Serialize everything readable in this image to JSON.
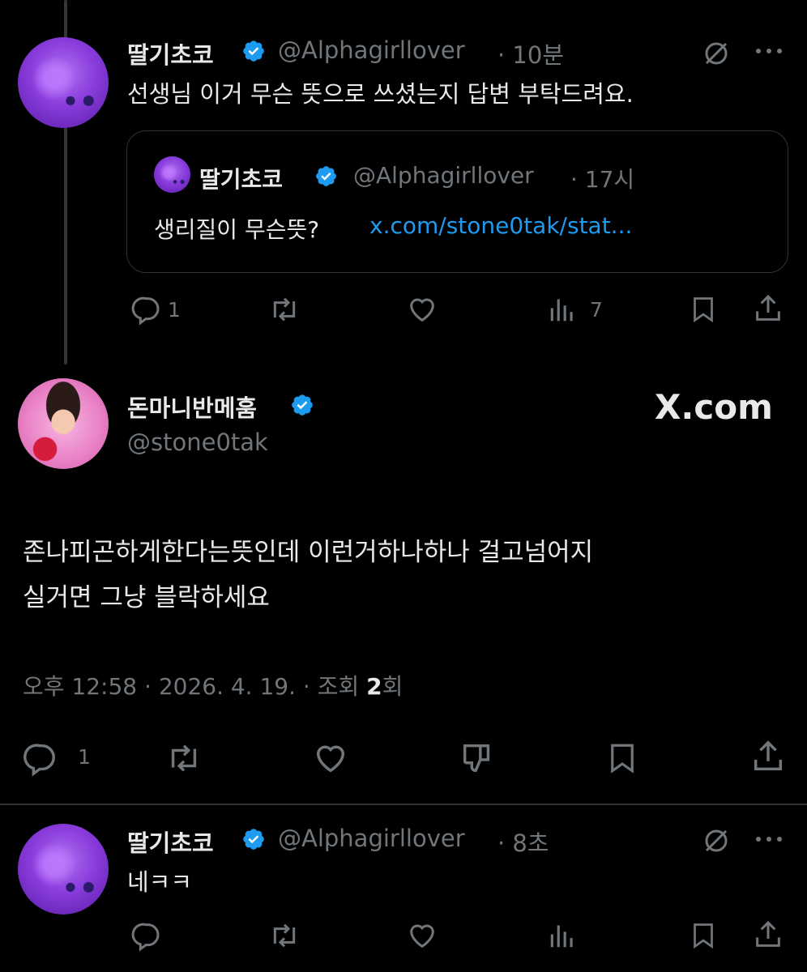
{
  "reply1": {
    "name": "딸기초코",
    "handle": "@Alphagirllover",
    "time": "· 10분",
    "text": "선생님 이거 무슨 뜻으로 쓰셨는지 답변 부탁드려요.",
    "quote": {
      "name": "딸기초코",
      "handle": "@Alphagirllover",
      "time": "· 17시",
      "text": "생리질이 무슨뜻?",
      "link": "x.com/stone0tak/stat..."
    },
    "actions": {
      "reply_count": "1",
      "views_count": "7"
    }
  },
  "main": {
    "name": "돈마니반메훔",
    "handle": "@stone0tak",
    "brand": "X.com",
    "text_line1": "존나피곤하게한다는뜻인데 이런거하나하나 걸고넘어지",
    "text_line2": "실거면 그냥 블락하세요",
    "meta_prefix": "오후 12:58 · 2026. 4. 19. · 조회 ",
    "views": "2",
    "meta_suffix": "회",
    "actions": {
      "reply_count": "1"
    }
  },
  "reply2": {
    "name": "딸기초코",
    "handle": "@Alphagirllover",
    "time": "· 8초",
    "text": "네ㅋㅋ"
  },
  "colors": {
    "background": "#000000",
    "text": "#e7e9ea",
    "muted": "#71767b",
    "link": "#1d9bf0",
    "verified": "#1d9bf0"
  },
  "icons": [
    "verified-icon",
    "grok-icon",
    "more-icon",
    "reply-icon",
    "retweet-icon",
    "like-icon",
    "views-icon",
    "bookmark-icon",
    "share-icon",
    "dislike-icon"
  ]
}
